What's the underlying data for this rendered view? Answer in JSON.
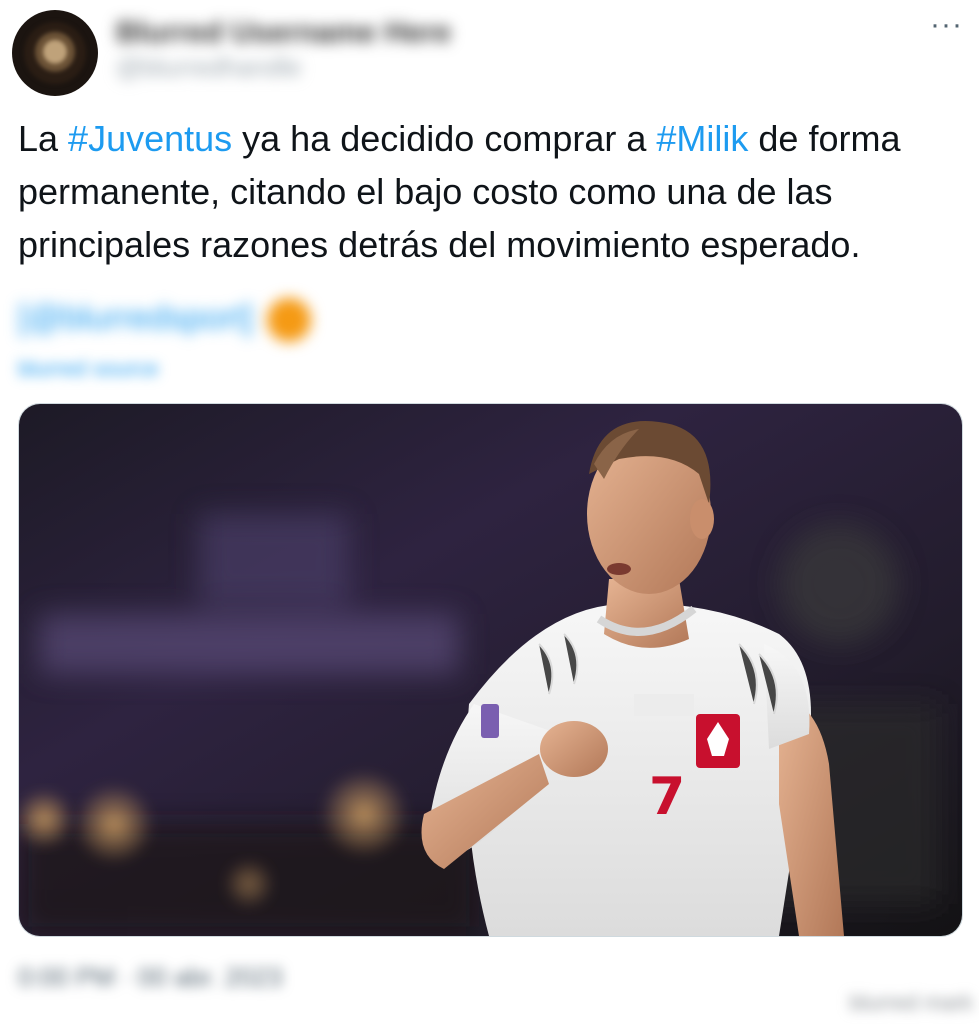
{
  "author": {
    "display_name": "Blurred Username Here",
    "handle": "@blurredhandle"
  },
  "menu": {
    "more_label": "···"
  },
  "tweet": {
    "parts": {
      "p1": "La ",
      "tag1": "#Juventus",
      "p2": " ya ha decidido comprar a ",
      "tag2": "#Milik",
      "p3": " de forma permanente, citando el bajo costo como una de las principales razones detrás del movimiento esperado."
    }
  },
  "source": {
    "label": "[@blurredsport]",
    "subtext": "blurred source"
  },
  "media": {
    "jersey_number": "7",
    "colors": {
      "background": "#2a1f3d",
      "shirt": "#f2f2f2",
      "accent": "#c8102e"
    }
  },
  "footer": {
    "timestamp": "0:00 PM · 00 abr. 2023",
    "watermark": "blurred mark"
  },
  "colors": {
    "link": "#1d9bf0",
    "text": "#0f1419",
    "muted": "#536471"
  }
}
